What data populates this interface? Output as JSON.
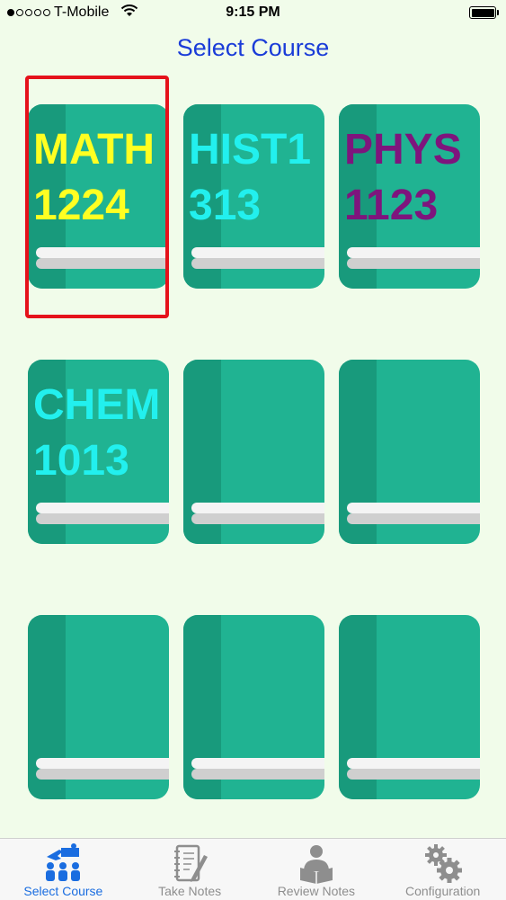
{
  "status_bar": {
    "carrier": "T-Mobile",
    "time": "9:15 PM",
    "signal_filled": 1,
    "signal_total": 5,
    "battery_level": 1.0,
    "wifi_icon": "wifi-icon",
    "battery_icon": "battery-icon"
  },
  "title": "Select Course",
  "courses": [
    {
      "line1": "MATH",
      "line2": "1224",
      "color": "#ffff22"
    },
    {
      "line1": "HIST1",
      "line2": "313",
      "color": "#22f0ee"
    },
    {
      "line1": "PHYS",
      "line2": "1123",
      "color": "#7e157d"
    },
    {
      "line1": "CHEM",
      "line2": "1013",
      "color": "#22f0ee"
    },
    {
      "line1": "",
      "line2": "",
      "color": ""
    },
    {
      "line1": "",
      "line2": "",
      "color": ""
    },
    {
      "line1": "",
      "line2": "",
      "color": ""
    },
    {
      "line1": "",
      "line2": "",
      "color": ""
    },
    {
      "line1": "",
      "line2": "",
      "color": ""
    }
  ],
  "selected_index": 0,
  "colors": {
    "background": "#f1fcea",
    "book": "#20b392",
    "book_spine": "#189a7c",
    "selection": "#e5121b",
    "title": "#1a3cd8",
    "tab_active": "#1a6de0",
    "tab_inactive": "#8e8e8e"
  },
  "tabs": [
    {
      "label": "Select Course",
      "icon": "teacher-students-icon",
      "active": true
    },
    {
      "label": "Take Notes",
      "icon": "notepad-pencil-icon",
      "active": false
    },
    {
      "label": "Review Notes",
      "icon": "reader-book-icon",
      "active": false
    },
    {
      "label": "Configuration",
      "icon": "gears-icon",
      "active": false
    }
  ]
}
